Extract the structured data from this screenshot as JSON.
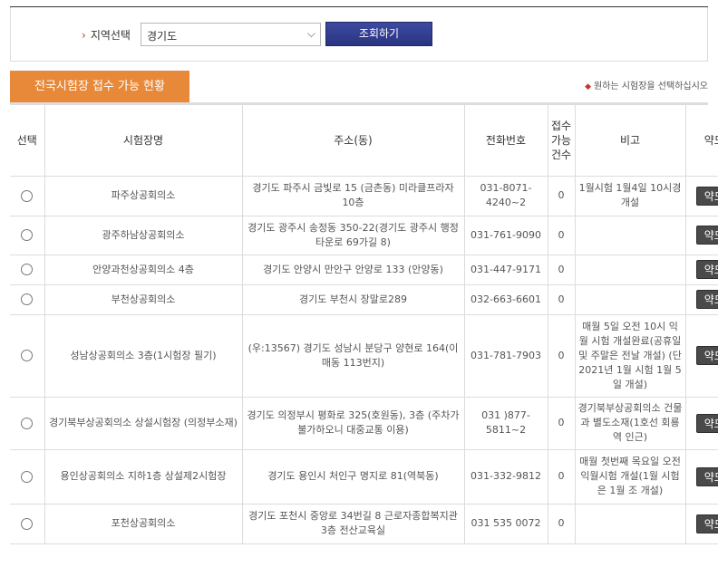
{
  "search": {
    "region_label": "지역선택",
    "region_value": "경기도",
    "submit_label": "조회하기"
  },
  "section": {
    "tab_label": "전국시험장 접수 가능 현황",
    "hint": "원하는 시험장을 선택하십시오"
  },
  "table": {
    "headers": {
      "select": "선택",
      "name": "시험장명",
      "address": "주소(동)",
      "phone": "전화번호",
      "count": "접수가능건수",
      "note": "비고",
      "map": "약도"
    },
    "rows": [
      {
        "name": "파주상공회의소",
        "address": "경기도 파주시 금빛로 15 (금촌동) 미라클프라자 10층",
        "phone": "031-8071-4240~2",
        "count": "0",
        "note": "1월시험 1월4일 10시경 개설",
        "map": "약도"
      },
      {
        "name": "광주하남상공회의소",
        "address": "경기도 광주시 송정동 350-22(경기도 광주시 행정타운로 69가길 8)",
        "phone": "031-761-9090",
        "count": "0",
        "note": "",
        "map": "약도"
      },
      {
        "name": "안양과천상공회의소 4층",
        "address": "경기도 안양시 만안구 안양로 133 (안양동)",
        "phone": "031-447-9171",
        "count": "0",
        "note": "",
        "map": "약도"
      },
      {
        "name": "부천상공회의소",
        "address": "경기도 부천시 장말로289",
        "phone": "032-663-6601",
        "count": "0",
        "note": "",
        "map": "약도"
      },
      {
        "name": "성남상공회의소 3층(1시험장 필기)",
        "address": "(우:13567) 경기도 성남시 분당구 양현로 164(이매동 113번지)",
        "phone": "031-781-7903",
        "count": "0",
        "note": "매월 5일 오전 10시 익월 시험 개설완료(공휴일 및 주말은 전날 개설) (단 2021년 1월 시험 1월 5일 개설)",
        "map": "약도"
      },
      {
        "name": "경기북부상공회의소 상설시험장 (의정부소재)",
        "address": "경기도 의정부시 평화로 325(호원동), 3층 (주차가 불가하오니 대중교통 이용)",
        "phone": "031 )877-5811~2",
        "count": "0",
        "note": "경기북부상공회의소 건물과 별도소재(1호선 회룡역 인근)",
        "map": "약도"
      },
      {
        "name": "용인상공회의소 지하1층 상설제2시험장",
        "address": "경기도 용인시 처인구 명지로 81(역북동)",
        "phone": "031-332-9812",
        "count": "0",
        "note": "매월 첫번째 목요일 오전 익월시험 개설(1월 시험은 1월 조 개설)",
        "map": "약도"
      },
      {
        "name": "포천상공회의소",
        "address": "경기도 포천시 중앙로 34번길 8 근로자종합복지관 3층 전산교육실",
        "phone": "031 535 0072",
        "count": "0",
        "note": "",
        "map": "약도"
      }
    ]
  }
}
